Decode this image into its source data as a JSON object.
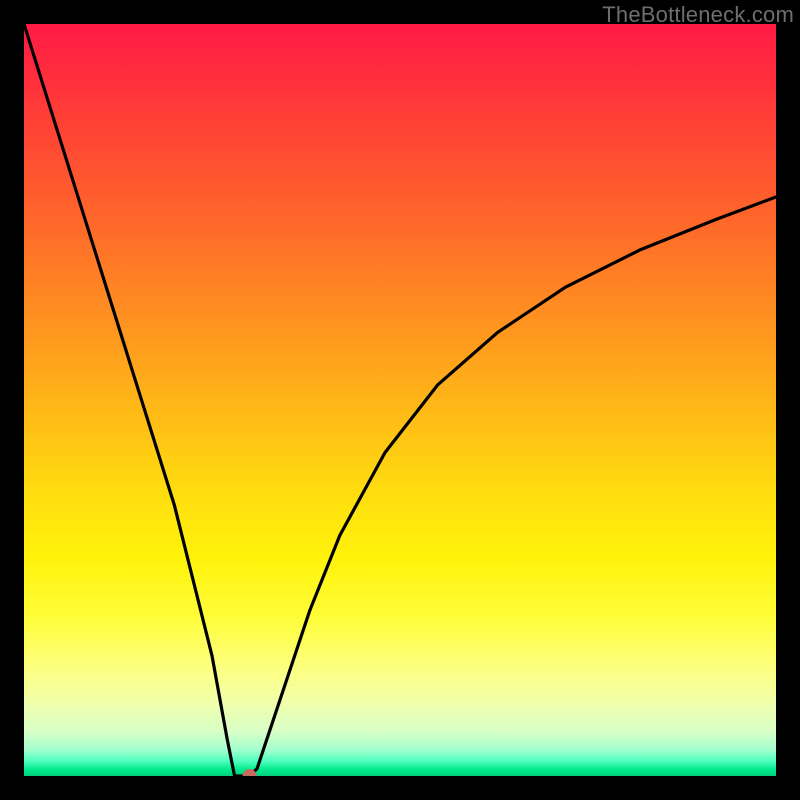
{
  "watermark": "TheBottleneck.com",
  "chart_data": {
    "type": "line",
    "title": "",
    "xlabel": "",
    "ylabel": "",
    "xlim": [
      0,
      100
    ],
    "ylim": [
      0,
      100
    ],
    "grid": false,
    "legend": false,
    "series": [
      {
        "name": "bottleneck-curve",
        "x": [
          0,
          5,
          10,
          15,
          20,
          25,
          27,
          28,
          30,
          31,
          32,
          35,
          38,
          42,
          48,
          55,
          63,
          72,
          82,
          92,
          100
        ],
        "values": [
          100,
          84,
          68,
          52,
          36,
          16,
          5,
          0,
          0,
          1,
          4,
          13,
          22,
          32,
          43,
          52,
          59,
          65,
          70,
          74,
          77
        ]
      }
    ],
    "marker": {
      "x": 30,
      "y": 0,
      "color": "#c76a5f",
      "radius_px": 7
    },
    "gradient_stops": [
      {
        "pos": 0.0,
        "color": "#ff1a44"
      },
      {
        "pos": 0.32,
        "color": "#ff7a26"
      },
      {
        "pos": 0.62,
        "color": "#ffdc0f"
      },
      {
        "pos": 0.85,
        "color": "#fdff7a"
      },
      {
        "pos": 0.97,
        "color": "#4fffbe"
      },
      {
        "pos": 1.0,
        "color": "#00d07c"
      }
    ]
  }
}
